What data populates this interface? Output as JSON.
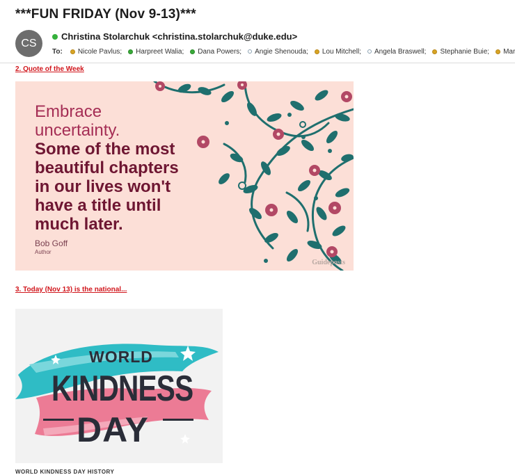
{
  "email": {
    "subject": "***FUN FRIDAY (Nov 9-13)***",
    "avatar_initials": "CS",
    "from": "Christina Stolarchuk <christina.stolarchuk@duke.edu>",
    "to_label": "To:",
    "recipients": [
      {
        "name": "Nicole Pavlus;",
        "status": "yellow"
      },
      {
        "name": "Harpreet Walia;",
        "status": "green"
      },
      {
        "name": "Dana Powers;",
        "status": "green"
      },
      {
        "name": "Angie Shenouda;",
        "status": "grey"
      },
      {
        "name": "Lou Mitchell;",
        "status": "yellow"
      },
      {
        "name": "Angela Braswell;",
        "status": "grey"
      },
      {
        "name": "Stephanie Buie;",
        "status": "yellow"
      },
      {
        "name": "Mar",
        "status": "yellow"
      }
    ]
  },
  "body": {
    "section2_heading": "2. Quote of the Week",
    "quote": {
      "line1": "Embrace",
      "line2": "uncertainty.",
      "line3": "Some of the most",
      "line4": "beautiful chapters",
      "line5": "in our lives won't",
      "line6": "have a title until",
      "line7": "much later.",
      "author": "Bob Goff",
      "role": "Author",
      "watermark": "Guideposts"
    },
    "section3_heading": "3. Today (Nov 13) is the national...",
    "kindness_image": {
      "line1": "WORLD",
      "line2": "KINDNESS",
      "line3": "DAY"
    },
    "footer_text": "WORLD KINDNESS DAY HISTORY"
  },
  "colors": {
    "link_red": "#d1161c",
    "quote_bg": "#fcdfd7",
    "vine_teal": "#1f6f6e",
    "flower_pink": "#b24865",
    "brush_teal": "#2fbcc5",
    "brush_pink": "#ec7b95"
  }
}
